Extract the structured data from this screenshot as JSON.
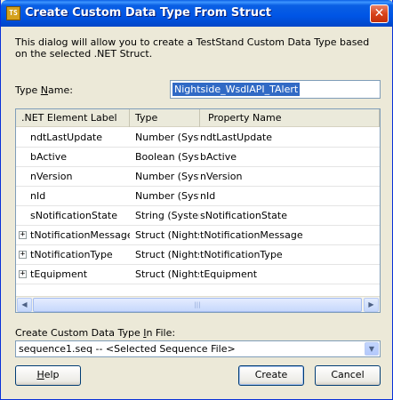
{
  "window": {
    "title": "Create Custom Data Type From Struct",
    "icon_name": "teststand-app-icon",
    "close_glyph": "✕"
  },
  "description": "This dialog will allow you to create a TestStand Custom Data Type based on the selected .NET Struct.",
  "type_name": {
    "label_prefix": "Type ",
    "label_accel": "N",
    "label_suffix": "ame:",
    "value": "Nightside_WsdlAPI_TAlert"
  },
  "grid": {
    "columns": [
      ".NET Element Label",
      "Type",
      "Property Name"
    ],
    "rows": [
      {
        "label": "ndtLastUpdate",
        "type": "Number (System",
        "property": "ndtLastUpdate",
        "expandable": false
      },
      {
        "label": "bActive",
        "type": "Boolean (Syste",
        "property": "bActive",
        "expandable": false
      },
      {
        "label": "nVersion",
        "type": "Number (System",
        "property": "nVersion",
        "expandable": false
      },
      {
        "label": "nId",
        "type": "Number (System",
        "property": "nId",
        "expandable": false
      },
      {
        "label": "sNotificationState",
        "type": "String (System.",
        "property": "sNotificationState",
        "expandable": false
      },
      {
        "label": "tNotificationMessage",
        "type": "Struct (Nightsic",
        "property": "tNotificationMessage",
        "expandable": true
      },
      {
        "label": "tNotificationType",
        "type": "Struct (Nightsic",
        "property": "tNotificationType",
        "expandable": true
      },
      {
        "label": "tEquipment",
        "type": "Struct (Nightsic",
        "property": "tEquipment",
        "expandable": true
      }
    ],
    "expander_glyph": "+"
  },
  "scrollbar": {
    "left_glyph": "◀",
    "right_glyph": "▶",
    "thumb_grip": "|||"
  },
  "file": {
    "label_prefix": "Create Custom Data Type ",
    "label_accel": "I",
    "label_suffix": "n File:",
    "value": "sequence1.seq  -- <Selected Sequence File>",
    "dropdown_glyph": "▼"
  },
  "buttons": {
    "help": {
      "accel": "H",
      "rest": "elp"
    },
    "create": "Create",
    "cancel": "Cancel"
  }
}
